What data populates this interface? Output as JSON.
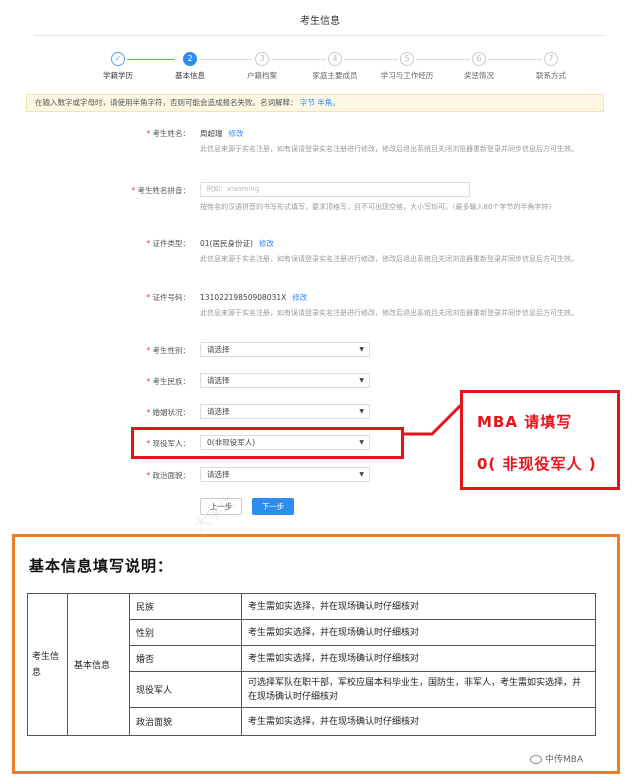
{
  "page": {
    "title": "考生信息"
  },
  "steps": [
    {
      "num": "✓",
      "label": "学籍学历",
      "state": "done"
    },
    {
      "num": "2",
      "label": "基本信息",
      "state": "active"
    },
    {
      "num": "3",
      "label": "户籍档案",
      "state": "todo"
    },
    {
      "num": "4",
      "label": "家庭主要成员",
      "state": "todo"
    },
    {
      "num": "5",
      "label": "学习与工作经历",
      "state": "todo"
    },
    {
      "num": "6",
      "label": "奖惩情况",
      "state": "todo"
    },
    {
      "num": "7",
      "label": "联系方式",
      "state": "todo"
    }
  ],
  "notice": {
    "text": "在输入数字或字母时，请使用半角字符，否则可能会造成报名失败。名词解释：",
    "link1": "字节",
    "link2": "半角。"
  },
  "form": {
    "name": {
      "label": "考生姓名：",
      "value": "周超瑞",
      "edit": "修改",
      "hint": "此信息来源于实名注册，如有误请登录实名注册进行修改，修改后退出系统且关闭浏览器重新登录并同步信息后方可生效。"
    },
    "pinyin": {
      "label": "考生姓名拼音：",
      "placeholder": "例如：xiaoming",
      "hint": "按姓名的汉语拼音的书写形式填写，要求顶格写，且不可出现空格，大小写均可。（最多输入80个字节的半角字符）"
    },
    "id_type": {
      "label": "证件类型：",
      "value": "01(居民身份证)",
      "edit": "修改",
      "hint": "此信息来源于实名注册，如有误请登录实名注册进行修改，修改后退出系统且关闭浏览器重新登录并同步信息后方可生效。"
    },
    "id_number": {
      "label": "证件号码：",
      "value": "13102219850908031X",
      "edit": "修改",
      "hint": "此信息来源于实名注册，如有误请登录实名注册进行修改，修改后退出系统且关闭浏览器重新登录并同步信息后方可生效。"
    },
    "gender": {
      "label": "考生性别：",
      "value": "请选择"
    },
    "ethnicity": {
      "label": "考生民族：",
      "value": "请选择"
    },
    "marital": {
      "label": "婚姻状况：",
      "value": "请选择"
    },
    "military": {
      "label": "现役军人：",
      "value": "0(非现役军人)"
    },
    "political": {
      "label": "政治面貌：",
      "value": "请选择"
    }
  },
  "buttons": {
    "prev": "上一步",
    "next": "下一步"
  },
  "callout": {
    "line1": "MBA 请填写",
    "line2": "0( 非现役军人 )"
  },
  "explain": {
    "heading": "基本信息填写说明：",
    "category": "考生信息",
    "subcategory": "基本信息",
    "rows": [
      {
        "field": "民族",
        "desc": "考生需如实选择，并在现场确认时仔细核对"
      },
      {
        "field": "性别",
        "desc": "考生需如实选择，并在现场确认时仔细核对"
      },
      {
        "field": "婚否",
        "desc": "考生需如实选择，并在现场确认时仔细核对"
      },
      {
        "field": "现役军人",
        "desc": "可选择军队在职干部，军校应届本科毕业生，国防生，非军人，考生需如实选择，并在现场确认时仔细核对"
      },
      {
        "field": "政治面貌",
        "desc": "考生需如实选择，并在现场确认时仔细核对"
      }
    ]
  },
  "source": "中传MBA",
  "colors": {
    "primary": "#2d8cf0",
    "annotation_red": "#e5141a",
    "frame_orange": "#ef7d24"
  }
}
